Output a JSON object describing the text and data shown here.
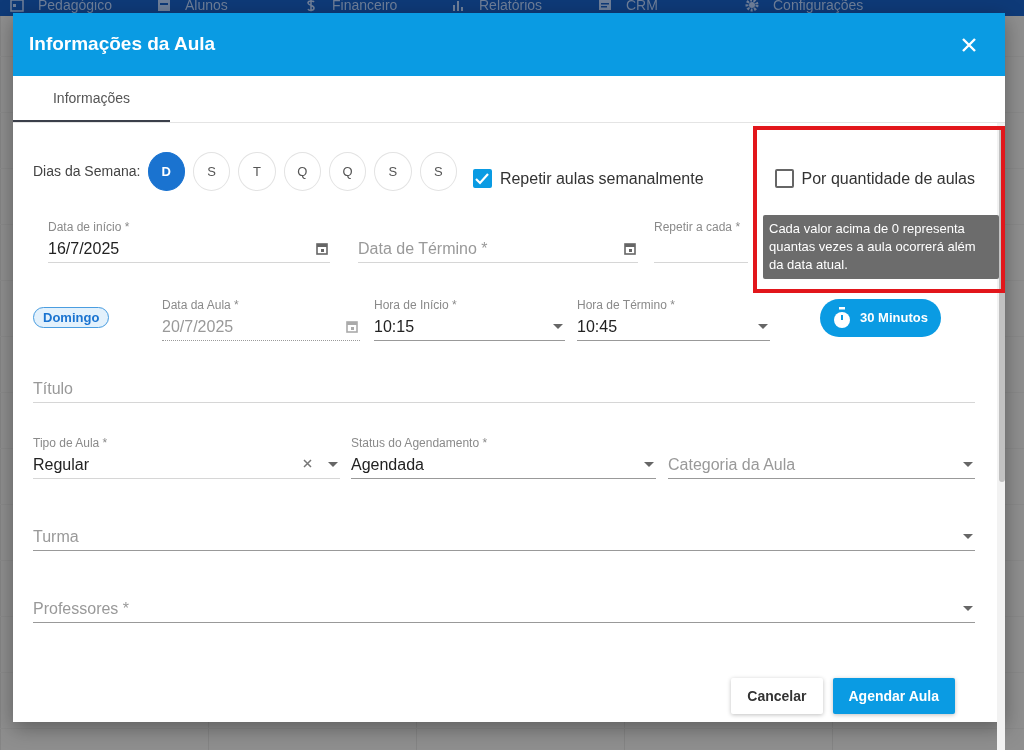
{
  "nav": [
    {
      "label": "Pedagógico"
    },
    {
      "label": "Alunos"
    },
    {
      "label": "Financeiro"
    },
    {
      "label": "Relatórios"
    },
    {
      "label": "CRM"
    },
    {
      "label": "Configurações"
    }
  ],
  "dialog": {
    "title": "Informações da Aula"
  },
  "tabs": [
    {
      "label": "Informações",
      "selected": true
    }
  ],
  "weekdays": {
    "label": "Dias da Semana:",
    "days": [
      {
        "letter": "D",
        "selected": true
      },
      {
        "letter": "S",
        "selected": false
      },
      {
        "letter": "T",
        "selected": false
      },
      {
        "letter": "Q",
        "selected": false
      },
      {
        "letter": "Q",
        "selected": false
      },
      {
        "letter": "S",
        "selected": false
      },
      {
        "letter": "S",
        "selected": false
      }
    ]
  },
  "repeat_weekly": {
    "label": "Repetir aulas semanalmente",
    "checked": true
  },
  "by_quantity": {
    "label": "Por quantidade de aulas",
    "checked": false
  },
  "tooltip": "Cada valor acima de 0 representa quantas vezes a aula ocorrerá além da data atual.",
  "start_date": {
    "label": "Data de início *",
    "value": "16/7/2025"
  },
  "end_date": {
    "placeholder": "Data de Término *"
  },
  "repeat_every": {
    "label": "Repetir a cada *"
  },
  "day_badge": "Domingo",
  "class_date": {
    "label": "Data da Aula *",
    "value": "20/7/2025",
    "disabled": true
  },
  "start_time": {
    "label": "Hora de Início *",
    "value": "10:15"
  },
  "end_time": {
    "label": "Hora de Término *",
    "value": "10:45"
  },
  "duration": "30 Minutos",
  "title_field": {
    "placeholder": "Título"
  },
  "class_type": {
    "label": "Tipo de Aula *",
    "value": "Regular"
  },
  "status": {
    "label": "Status do Agendamento *",
    "value": "Agendada"
  },
  "category": {
    "placeholder": "Categoria da Aula"
  },
  "group": {
    "placeholder": "Turma"
  },
  "teachers": {
    "placeholder": "Professores *"
  },
  "buttons": [
    {
      "label": "Cancelar",
      "kind": "secondary"
    },
    {
      "label": "Agendar Aula",
      "kind": "primary"
    }
  ]
}
